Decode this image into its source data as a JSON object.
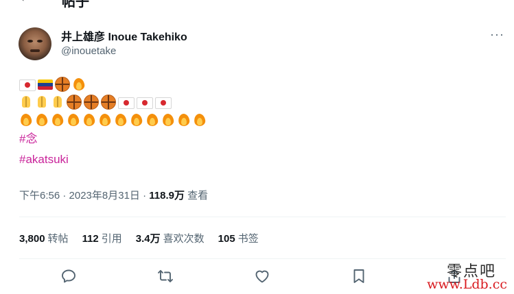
{
  "header": {
    "back_icon": "arrow-left-icon",
    "title": "帖子"
  },
  "author": {
    "display_name": "井上雄彦 Inoue Takehiko",
    "handle": "@inouetake"
  },
  "tweet": {
    "emoji_lines": [
      [
        "flag-japan",
        "flag-venezuela",
        "basketball",
        "fire"
      ],
      [
        "folded-hands",
        "folded-hands",
        "folded-hands",
        "basketball",
        "basketball",
        "basketball",
        "flag-japan",
        "flag-japan",
        "flag-japan"
      ],
      [
        "fire",
        "fire",
        "fire",
        "fire",
        "fire",
        "fire",
        "fire",
        "fire",
        "fire",
        "fire",
        "fire",
        "fire"
      ]
    ],
    "hashtags": [
      "#念",
      "#akatsuki"
    ],
    "time": "下午6:56 · 2023年8月31日 · ",
    "views_number": "118.9万",
    "views_label": " 查看"
  },
  "stats": {
    "retweets": {
      "number": "3,800",
      "label": "转帖"
    },
    "quotes": {
      "number": "112",
      "label": "引用"
    },
    "likes": {
      "number": "3.4万",
      "label": "喜欢次数"
    },
    "bookmarks": {
      "number": "105",
      "label": "书签"
    }
  },
  "actions": [
    "reply-icon",
    "retweet-icon",
    "like-icon",
    "bookmark-icon",
    "share-icon"
  ],
  "watermark": {
    "text": "零点吧",
    "url": "www.Ldb.cc"
  },
  "colors": {
    "hashtag": "#c9239a",
    "secondary_text": "#536471",
    "primary_text": "#0f1419"
  }
}
